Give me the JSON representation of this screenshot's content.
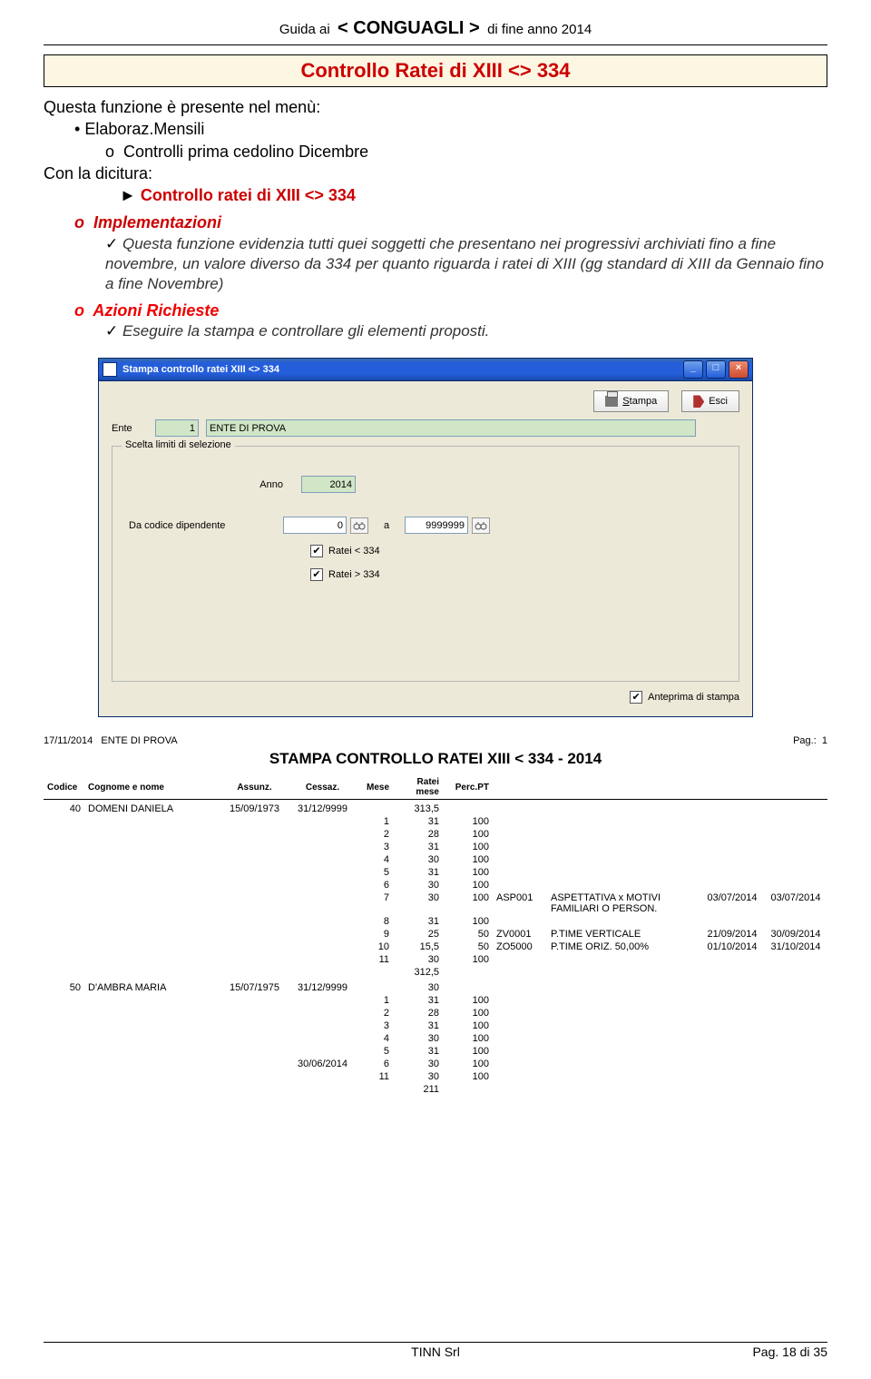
{
  "header": {
    "guida": "Guida ai",
    "conguagli": "< CONGUAGLI >",
    "fine": "di fine anno 2014"
  },
  "title": "Controllo Ratei di XIII <> 334",
  "intro": {
    "l1": "Questa funzione è presente nel menù:",
    "b1": "Elaboraz.Mensili",
    "b2": "Controlli prima cedolino Dicembre",
    "l2": "Con la dicitura:",
    "arrow": "Controllo ratei di XIII <> 334",
    "impl": "Implementazioni",
    "impl_text": "Questa funzione evidenzia tutti quei soggetti che presentano nei progressivi archiviati fino a fine novembre, un valore diverso da 334 per quanto riguarda i ratei di XIII (gg standard di XIII da Gennaio fino a fine Novembre)",
    "azioni": "Azioni Richieste",
    "azioni_text": "Eseguire la stampa e controllare gli elementi proposti."
  },
  "win": {
    "title": "Stampa controllo ratei XIII <> 334",
    "stampa": "Stampa",
    "esci": "Esci",
    "ente_lbl": "Ente",
    "ente_code": "1",
    "ente_name": "ENTE DI PROVA",
    "fieldset": "Scelta limiti di selezione",
    "anno_lbl": "Anno",
    "anno": "2014",
    "dacod_lbl": "Da codice dipendente",
    "dacod": "0",
    "a_lbl": "a",
    "acod": "9999999",
    "chk1": "Ratei < 334",
    "chk2": "Ratei > 334",
    "anteprima": "Anteprima di stampa"
  },
  "report": {
    "date": "17/11/2014",
    "ente": "ENTE DI PROVA",
    "pag_lbl": "Pag.:",
    "pag": "1",
    "title": "STAMPA CONTROLLO RATEI XIII < 334 - 2014",
    "cols": {
      "codice": "Codice",
      "cognome": "Cognome e nome",
      "assunz": "Assunz.",
      "cessaz": "Cessaz.",
      "mese": "Mese",
      "ratei": "Ratei mese",
      "perc": "Perc.PT"
    },
    "emp1": {
      "code": "40",
      "name": "DOMENI DANIELA",
      "ass": "15/09/1973",
      "cess": "31/12/9999",
      "tot": "313,5"
    },
    "emp1_rows": [
      {
        "m": "1",
        "r": "31",
        "p": "100",
        "note": "",
        "nd": "",
        "d1": "",
        "d2": ""
      },
      {
        "m": "2",
        "r": "28",
        "p": "100",
        "note": "",
        "nd": "",
        "d1": "",
        "d2": ""
      },
      {
        "m": "3",
        "r": "31",
        "p": "100",
        "note": "",
        "nd": "",
        "d1": "",
        "d2": ""
      },
      {
        "m": "4",
        "r": "30",
        "p": "100",
        "note": "",
        "nd": "",
        "d1": "",
        "d2": ""
      },
      {
        "m": "5",
        "r": "31",
        "p": "100",
        "note": "",
        "nd": "",
        "d1": "",
        "d2": ""
      },
      {
        "m": "6",
        "r": "30",
        "p": "100",
        "note": "",
        "nd": "",
        "d1": "",
        "d2": ""
      },
      {
        "m": "7",
        "r": "30",
        "p": "100",
        "note": "ASP001",
        "nd": "ASPETTATIVA x MOTIVI FAMILIARI O PERSON.",
        "d1": "03/07/2014",
        "d2": "03/07/2014"
      },
      {
        "m": "8",
        "r": "31",
        "p": "100",
        "note": "",
        "nd": "",
        "d1": "",
        "d2": ""
      },
      {
        "m": "9",
        "r": "25",
        "p": "50",
        "note": "ZV0001",
        "nd": "P.TIME VERTICALE",
        "d1": "21/09/2014",
        "d2": "30/09/2014"
      },
      {
        "m": "10",
        "r": "15,5",
        "p": "50",
        "note": "ZO5000",
        "nd": "P.TIME ORIZ. 50,00%",
        "d1": "01/10/2014",
        "d2": "31/10/2014"
      },
      {
        "m": "11",
        "r": "30",
        "p": "100",
        "note": "",
        "nd": "",
        "d1": "",
        "d2": ""
      }
    ],
    "emp1_sub": "312,5",
    "emp2": {
      "code": "50",
      "name": "D'AMBRA MARIA",
      "ass": "15/07/1975",
      "cess": "31/12/9999",
      "tot": "30",
      "cess2": "30/06/2014"
    },
    "emp2_rows": [
      {
        "m": "1",
        "r": "31",
        "p": "100"
      },
      {
        "m": "2",
        "r": "28",
        "p": "100"
      },
      {
        "m": "3",
        "r": "31",
        "p": "100"
      },
      {
        "m": "4",
        "r": "30",
        "p": "100"
      },
      {
        "m": "5",
        "r": "31",
        "p": "100"
      },
      {
        "m": "6",
        "r": "30",
        "p": "100"
      },
      {
        "m": "11",
        "r": "30",
        "p": "100"
      }
    ],
    "emp2_sub": "211"
  },
  "footer": {
    "tinn": "TINN Srl",
    "pag": "Pag. 18 di 35"
  }
}
